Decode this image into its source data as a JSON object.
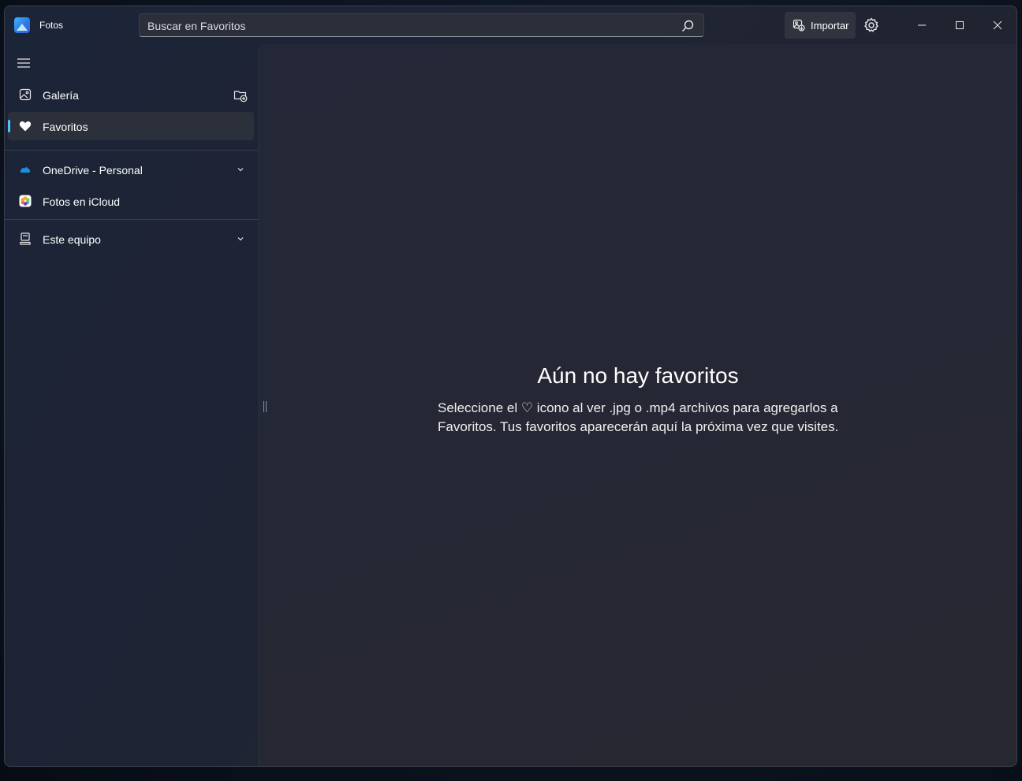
{
  "app": {
    "title": "Fotos"
  },
  "search": {
    "placeholder": "Buscar en Favoritos"
  },
  "toolbar": {
    "import_label": "Importar"
  },
  "sidebar": {
    "items": [
      {
        "label": "Galería",
        "icon": "gallery-icon"
      },
      {
        "label": "Favoritos",
        "icon": "heart-icon",
        "selected": true
      },
      {
        "label": "OneDrive - Personal",
        "icon": "onedrive-icon",
        "expandable": true
      },
      {
        "label": "Fotos en iCloud",
        "icon": "icloud-photos-icon"
      },
      {
        "label": "Este equipo",
        "icon": "computer-icon",
        "expandable": true
      }
    ]
  },
  "main": {
    "empty_title": "Aún no hay favoritos",
    "empty_description": "Seleccione el ♡ icono al ver .jpg o .mp4 archivos para agregarlos a Favoritos. Tus favoritos aparecerán aquí la próxima vez que visites."
  },
  "colors": {
    "accent": "#4cc2ff",
    "selected_bg": "#2c303b",
    "window_bg": "#1f2434"
  }
}
